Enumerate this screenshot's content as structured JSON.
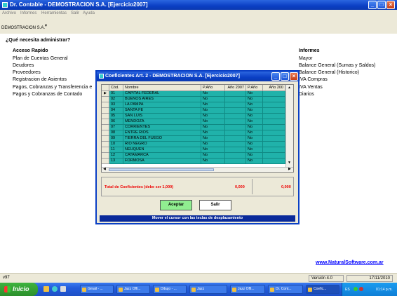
{
  "window": {
    "title": "Dr. Contable - DEMOSTRACION S.A.  [Ejercicio2007]",
    "menu": [
      "Archivo",
      "Informes",
      "Herramientas",
      "Salir",
      "Ayuda"
    ],
    "company_combo": "DEMOSTRACION S.A."
  },
  "main": {
    "question": "¿Qué necesita administrar?",
    "quick_access": {
      "header": "Acceso Rapido",
      "items": [
        "Plan de Cuentas General",
        "Deudores",
        "Proveedores",
        "Registracion de Asientos",
        "Pagos, Cobranzas y Transferencia e",
        "Pagos y Cobranzas de Contado"
      ]
    },
    "reports": {
      "header": "Informes",
      "items": [
        "Mayor",
        "Balance General (Sumas y Saldos)",
        "Balance General (Historico)",
        "IVA Compras",
        "IVA Ventas",
        "Diarios"
      ]
    },
    "link": "www.NaturalSoftware.com.ar"
  },
  "statusbar": {
    "version_code": "v97",
    "version": "Versión 4.0",
    "date": "17/11/2010"
  },
  "dialog": {
    "title": "Coeficientes Art. 2 - DEMOSTRACION S.A.  [Ejercicio2007]",
    "columns": [
      "Cód.",
      "Nombre",
      "P.Año",
      "Año 2007",
      "P.Año",
      "Año 200"
    ],
    "rows": [
      {
        "cod": "01",
        "nombre": "CAPITAL FEDERAL",
        "p1": "No",
        "p2": "No"
      },
      {
        "cod": "02",
        "nombre": "BUENOS AIRES",
        "p1": "No",
        "p2": "No"
      },
      {
        "cod": "03",
        "nombre": "LA PAMPA",
        "p1": "No",
        "p2": "No"
      },
      {
        "cod": "04",
        "nombre": "SANTA FE",
        "p1": "No",
        "p2": "No"
      },
      {
        "cod": "05",
        "nombre": "SAN LUIS",
        "p1": "No",
        "p2": "No"
      },
      {
        "cod": "06",
        "nombre": "MENDOZA",
        "p1": "No",
        "p2": "No"
      },
      {
        "cod": "07",
        "nombre": "CORRIENTES",
        "p1": "No",
        "p2": "No"
      },
      {
        "cod": "08",
        "nombre": "ENTRE RIOS",
        "p1": "No",
        "p2": "No"
      },
      {
        "cod": "09",
        "nombre": "TIERRA DEL FUEGO",
        "p1": "No",
        "p2": "No"
      },
      {
        "cod": "10",
        "nombre": "RIO NEGRO",
        "p1": "No",
        "p2": "No"
      },
      {
        "cod": "11",
        "nombre": "NEUQUEN",
        "p1": "No",
        "p2": "No"
      },
      {
        "cod": "12",
        "nombre": "CATAMARCA",
        "p1": "No",
        "p2": "No"
      },
      {
        "cod": "13",
        "nombre": "FORMOSA",
        "p1": "No",
        "p2": "No"
      }
    ],
    "total_label": "Total de Coeficientes (debe ser 1,000)",
    "total1": "0,000",
    "total2": "0,000",
    "accept": "Aceptar",
    "exit": "Salir",
    "status": "Mover el cursor con las teclas de desplazamiento"
  },
  "taskbar": {
    "start": "Inicio",
    "tasks": [
      "Gmail - ...",
      "Jazz Offi...",
      "Dibujo - ...",
      "Jazz",
      "Jazz Offi...",
      "Dr. Cont...",
      "Coefic..."
    ],
    "lang": "ES",
    "clock": "01:14 p.m."
  },
  "colors": {
    "grid_row": "#20b2aa",
    "title_bar": "#0a3fc4",
    "total_text": "#e00000",
    "accept_bg": "#90ee90"
  }
}
